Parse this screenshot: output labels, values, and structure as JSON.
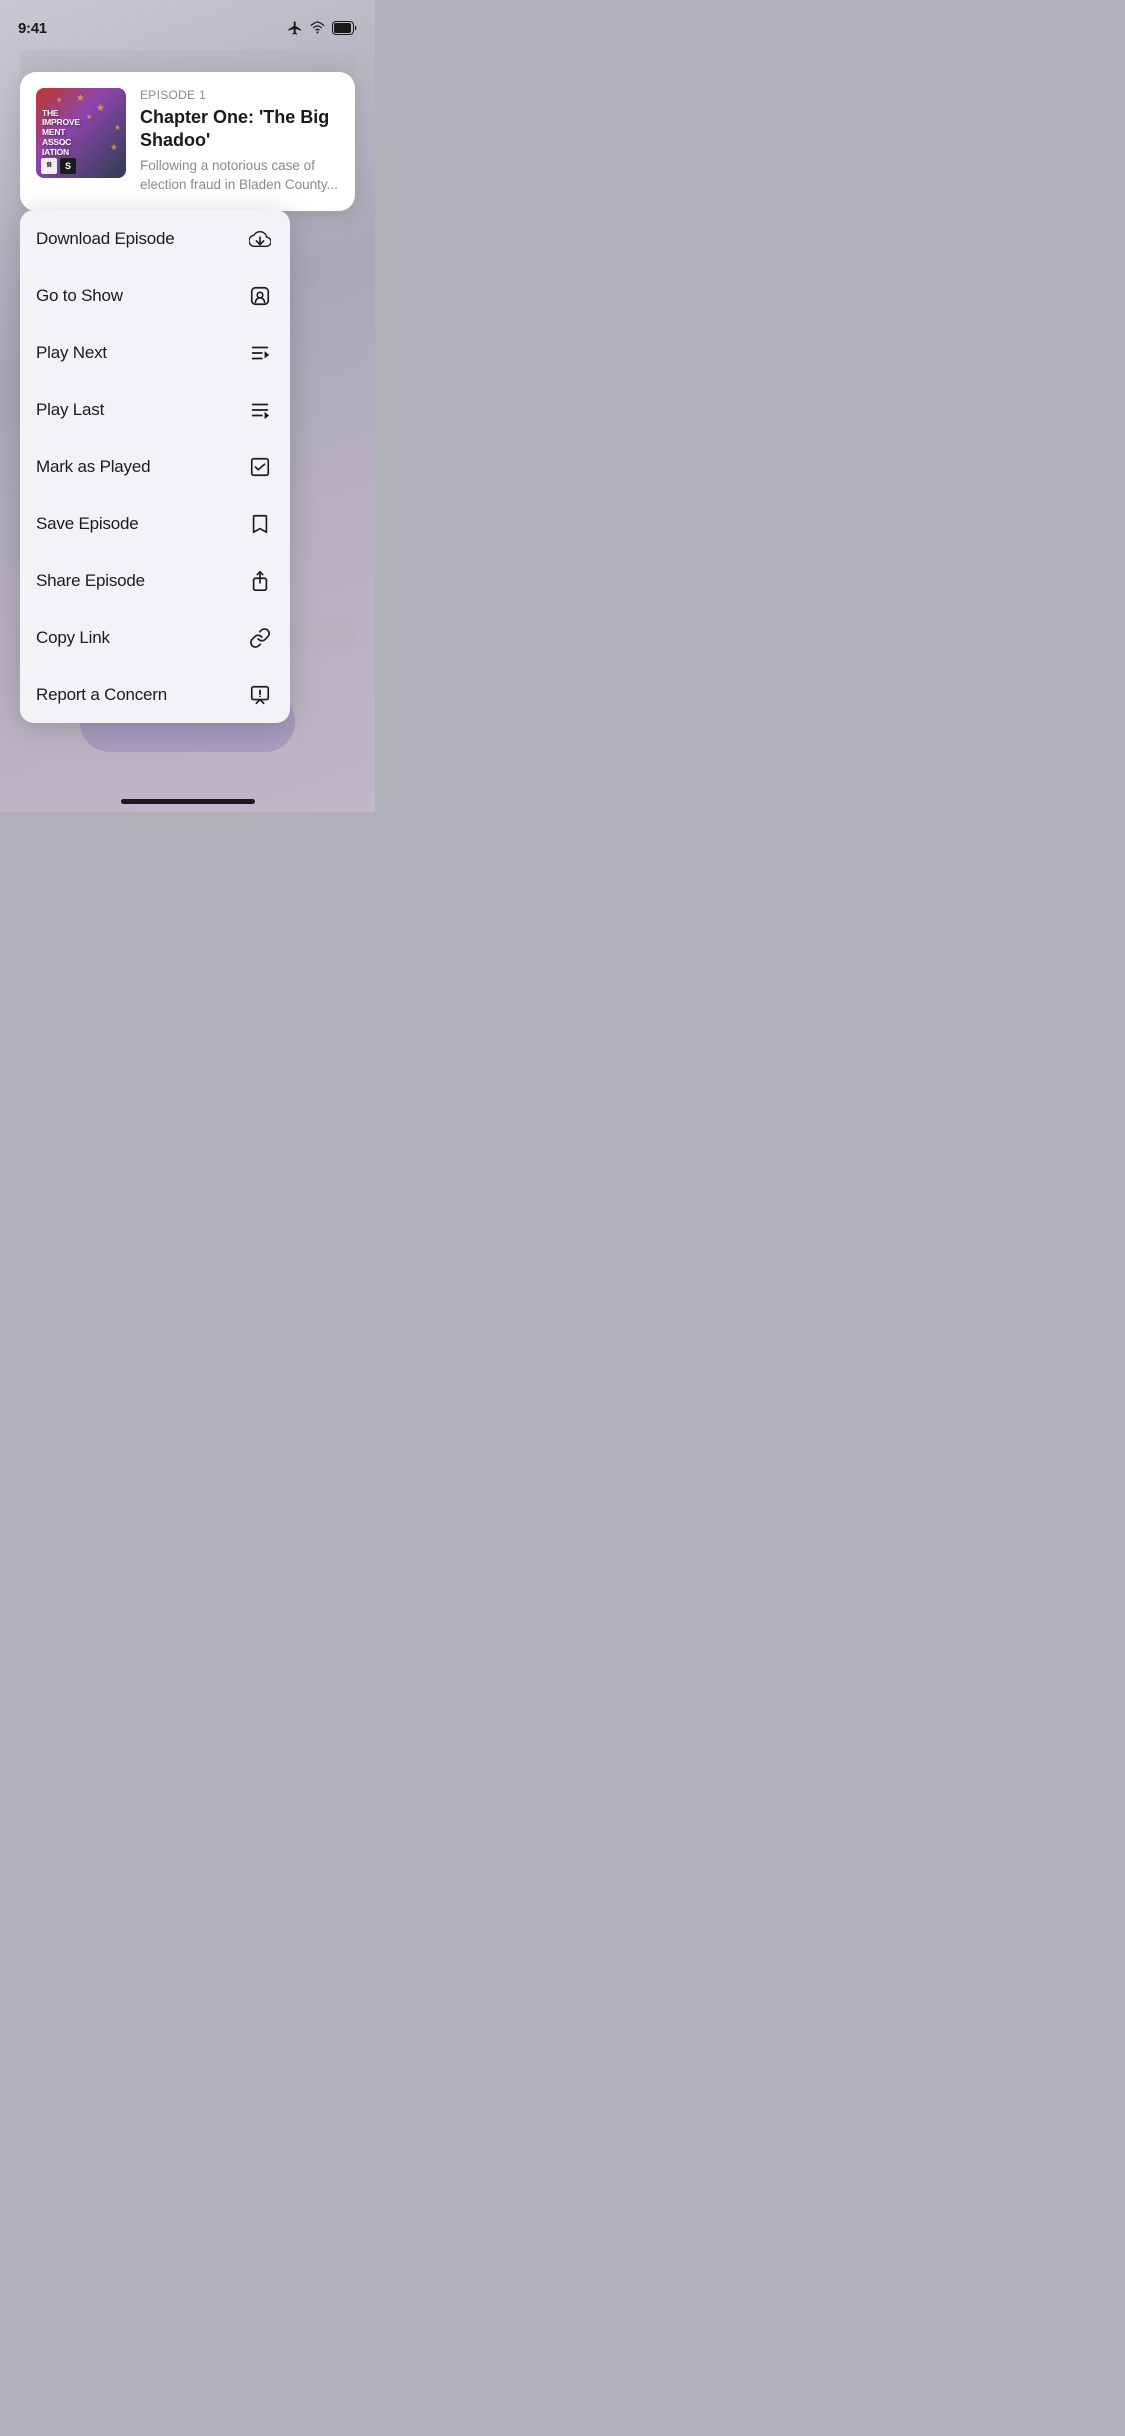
{
  "statusBar": {
    "time": "9:41"
  },
  "episodeCard": {
    "episodeNumber": "EPISODE 1",
    "title": "Chapter One: 'The Big Shadoo'",
    "description": "Following a notorious case of election fraud in Bladen County...",
    "artworkLines": [
      "THE",
      "IMPROVE",
      "MENT",
      "ASSOC",
      "IATION"
    ],
    "logo1": "🅣",
    "logo2": "S"
  },
  "menu": {
    "items": [
      {
        "label": "Download Episode",
        "icon": "download"
      },
      {
        "label": "Go to Show",
        "icon": "podcast"
      },
      {
        "label": "Play Next",
        "icon": "play-next"
      },
      {
        "label": "Play Last",
        "icon": "play-last"
      },
      {
        "label": "Mark as Played",
        "icon": "checkmark"
      },
      {
        "label": "Save Episode",
        "icon": "bookmark"
      },
      {
        "label": "Share Episode",
        "icon": "share"
      },
      {
        "label": "Copy Link",
        "icon": "link"
      },
      {
        "label": "Report a Concern",
        "icon": "report"
      }
    ]
  }
}
